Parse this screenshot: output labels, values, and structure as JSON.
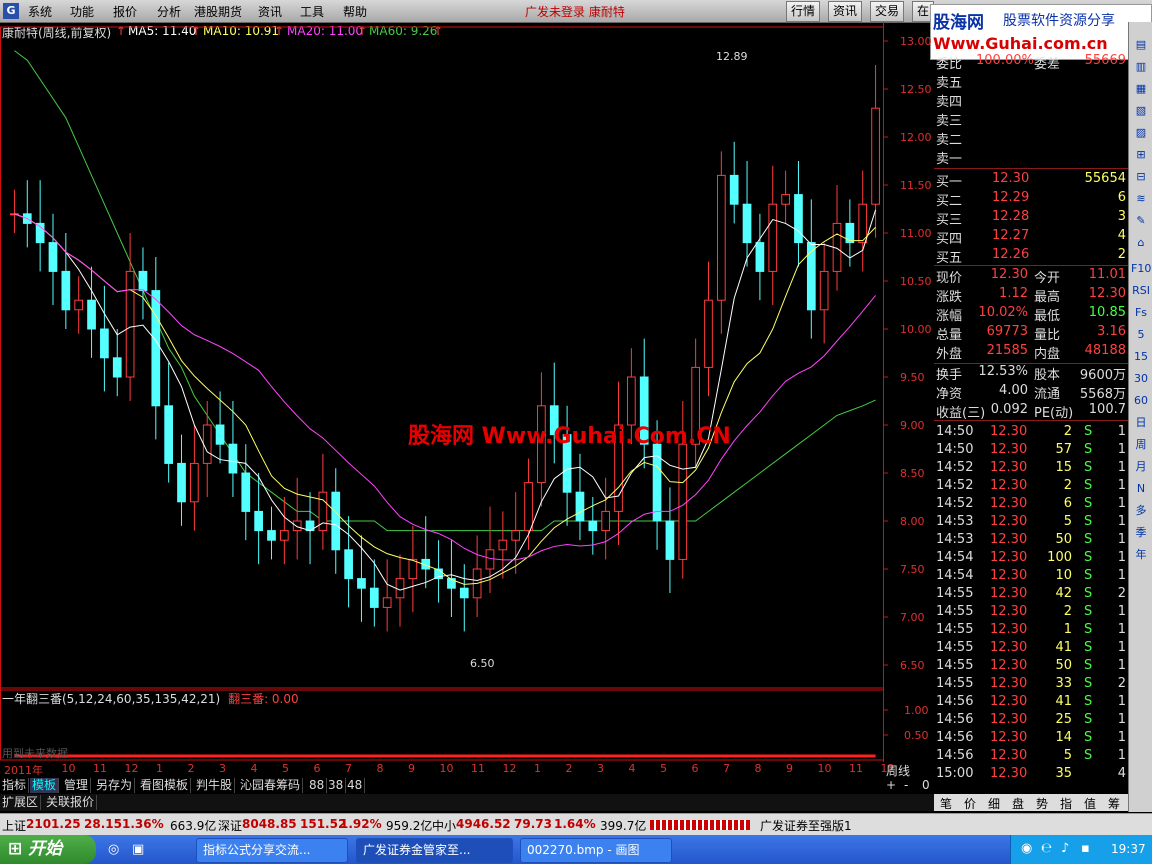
{
  "menubar": {
    "items": [
      "系统",
      "功能",
      "报价",
      "分析",
      "港股期货",
      "资讯",
      "工具",
      "帮助"
    ],
    "title": "广发未登录 康耐特",
    "right_buttons": [
      "行情",
      "资讯",
      "交易",
      "在"
    ]
  },
  "logo": {
    "name": "股海网",
    "slogan": "股票软件资源分享",
    "url": "Www.Guhai.com.cn"
  },
  "header": {
    "stock_label": "康耐特(周线,前复权)",
    "ma5": "MA5: 11.40",
    "ma10": "MA10: 10.91",
    "ma20": "MA20: 11.00",
    "ma60": "MA60: 9.26"
  },
  "colors": {
    "up": "#ff3c3c",
    "down": "#54ffff",
    "ma5": "#ffffff",
    "ma10": "#ffff66",
    "ma20": "#ff44ff",
    "ma60": "#44cc44",
    "axis": "#d01010",
    "signal": "#ff2020"
  },
  "price_axis": {
    "ticks": [
      "13.00",
      "12.50",
      "12.00",
      "11.50",
      "11.00",
      "10.50",
      "10.00",
      "9.50",
      "9.00",
      "8.50",
      "8.00",
      "7.50",
      "7.00",
      "6.50"
    ]
  },
  "price_labels": {
    "high": "12.89",
    "low": "6.50"
  },
  "indicator": {
    "label": "一年翻三番(5,12,24,60,35,135,42,21)",
    "value_label": "翻三番: 0.00",
    "ticks": [
      "1.00",
      "0.50"
    ],
    "note": "用到未来数据"
  },
  "time_axis": {
    "labels": [
      "2011年",
      "10",
      "11",
      "12",
      "1",
      "2",
      "3",
      "4",
      "5",
      "6",
      "7",
      "8",
      "9",
      "10",
      "11",
      "12",
      "1",
      "2",
      "3",
      "4",
      "5",
      "6",
      "7",
      "8",
      "9",
      "10",
      "11",
      "12"
    ],
    "period": "周线"
  },
  "watermark": "股海网 Www.Guhai.Com.CN",
  "tabs": [
    "指标",
    "模板",
    "管理",
    "另存为",
    "看图模板",
    "判牛股",
    "沁园春筹码",
    "88",
    "38",
    "48"
  ],
  "tabs2": [
    "扩展区",
    "关联报价"
  ],
  "zoom_buttons": [
    "+",
    "-",
    "0"
  ],
  "quote": {
    "webi": {
      "label": "委比",
      "value": "100.00%",
      "label2": "委差",
      "value2": "55669"
    },
    "sells": [
      "卖五",
      "卖四",
      "卖三",
      "卖二",
      "卖一"
    ],
    "buys": [
      {
        "label": "买一",
        "price": "12.30",
        "vol": "55654"
      },
      {
        "label": "买二",
        "price": "12.29",
        "vol": "6"
      },
      {
        "label": "买三",
        "price": "12.28",
        "vol": "3"
      },
      {
        "label": "买四",
        "price": "12.27",
        "vol": "4"
      },
      {
        "label": "买五",
        "price": "12.26",
        "vol": "2"
      }
    ],
    "stats": [
      {
        "l1": "现价",
        "v1": "12.30",
        "l2": "今开",
        "v2": "11.01"
      },
      {
        "l1": "涨跌",
        "v1": "1.12",
        "l2": "最高",
        "v2": "12.30"
      },
      {
        "l1": "涨幅",
        "v1": "10.02%",
        "l2": "最低",
        "v2": "10.85"
      },
      {
        "l1": "总量",
        "v1": "69773",
        "l2": "量比",
        "v2": "3.16"
      },
      {
        "l1": "外盘",
        "v1": "21585",
        "l2": "内盘",
        "v2": "48188"
      }
    ],
    "stats2": [
      {
        "l1": "换手",
        "v1": "12.53%",
        "l2": "股本",
        "v2": "9600万"
      },
      {
        "l1": "净资",
        "v1": "4.00",
        "l2": "流通",
        "v2": "5568万"
      },
      {
        "l1": "收益(三)",
        "v1": "0.092",
        "l2": "PE(动)",
        "v2": "100.7"
      }
    ],
    "ticks": [
      {
        "t": "14:50",
        "p": "12.30",
        "v": "2",
        "s": "S",
        "n": "1"
      },
      {
        "t": "14:50",
        "p": "12.30",
        "v": "57",
        "s": "S",
        "n": "1"
      },
      {
        "t": "14:52",
        "p": "12.30",
        "v": "15",
        "s": "S",
        "n": "1"
      },
      {
        "t": "14:52",
        "p": "12.30",
        "v": "2",
        "s": "S",
        "n": "1"
      },
      {
        "t": "14:52",
        "p": "12.30",
        "v": "6",
        "s": "S",
        "n": "1"
      },
      {
        "t": "14:53",
        "p": "12.30",
        "v": "5",
        "s": "S",
        "n": "1"
      },
      {
        "t": "14:53",
        "p": "12.30",
        "v": "50",
        "s": "S",
        "n": "1"
      },
      {
        "t": "14:54",
        "p": "12.30",
        "v": "100",
        "s": "S",
        "n": "1"
      },
      {
        "t": "14:54",
        "p": "12.30",
        "v": "10",
        "s": "S",
        "n": "1"
      },
      {
        "t": "14:55",
        "p": "12.30",
        "v": "42",
        "s": "S",
        "n": "2"
      },
      {
        "t": "14:55",
        "p": "12.30",
        "v": "2",
        "s": "S",
        "n": "1"
      },
      {
        "t": "14:55",
        "p": "12.30",
        "v": "1",
        "s": "S",
        "n": "1"
      },
      {
        "t": "14:55",
        "p": "12.30",
        "v": "41",
        "s": "S",
        "n": "1"
      },
      {
        "t": "14:55",
        "p": "12.30",
        "v": "50",
        "s": "S",
        "n": "1"
      },
      {
        "t": "14:55",
        "p": "12.30",
        "v": "33",
        "s": "S",
        "n": "2"
      },
      {
        "t": "14:56",
        "p": "12.30",
        "v": "41",
        "s": "S",
        "n": "1"
      },
      {
        "t": "14:56",
        "p": "12.30",
        "v": "25",
        "s": "S",
        "n": "1"
      },
      {
        "t": "14:56",
        "p": "12.30",
        "v": "14",
        "s": "S",
        "n": "1"
      },
      {
        "t": "14:56",
        "p": "12.30",
        "v": "5",
        "s": "S",
        "n": "1"
      },
      {
        "t": "15:00",
        "p": "12.30",
        "v": "35",
        "s": "",
        "n": "4"
      }
    ]
  },
  "right_tabs": [
    "笔",
    "价",
    "细",
    "盘",
    "势",
    "指",
    "值",
    "筹"
  ],
  "right_tools": [
    "F10",
    "RSI",
    "Fs",
    "5",
    "15",
    "30",
    "60",
    "日",
    "周",
    "月",
    "N",
    "多",
    "季",
    "年"
  ],
  "status": {
    "sh_label": "上证",
    "sh_index": "2101.25",
    "sh_chg": "28.15",
    "sh_pct": "1.36%",
    "sh_amt": "663.9亿",
    "sz_label": "深证",
    "sz_index": "8048.85",
    "sz_chg": "151.52",
    "sz_pct": "1.92%",
    "sz_amt": "959.2亿",
    "zx_label": "中小",
    "zx_index": "4946.52",
    "zx_chg": "79.73",
    "zx_pct": "1.64%",
    "zx_amt": "399.7亿",
    "broker": "广发证券至强版1"
  },
  "taskbar": {
    "start": "开始",
    "tasks": [
      "指标公式分享交流...",
      "广发证券金管家至...",
      "002270.bmp - 画图"
    ],
    "clock": "19:37"
  },
  "chart_data": {
    "type": "candlestick",
    "title": "康耐特(周线,前复权)",
    "ylim": [
      6.3,
      13.1
    ],
    "close_path_note": "weekly candles with MA5/MA10/MA20/MA60",
    "close": [
      11.2,
      11.1,
      10.9,
      10.6,
      10.2,
      10.3,
      10.0,
      9.7,
      9.5,
      10.6,
      10.4,
      9.2,
      8.6,
      8.2,
      8.6,
      9.0,
      8.8,
      8.5,
      8.1,
      7.9,
      7.8,
      7.9,
      8.0,
      7.9,
      8.3,
      7.7,
      7.4,
      7.3,
      7.1,
      7.2,
      7.4,
      7.6,
      7.5,
      7.4,
      7.3,
      7.2,
      7.5,
      7.7,
      7.8,
      7.9,
      8.4,
      9.2,
      8.9,
      8.3,
      8.0,
      7.9,
      8.1,
      9.0,
      9.5,
      8.8,
      8.0,
      7.6,
      8.8,
      9.6,
      10.3,
      11.6,
      11.3,
      10.9,
      10.6,
      11.3,
      11.4,
      10.9,
      10.2,
      10.6,
      11.1,
      10.9,
      11.3,
      12.3
    ],
    "ma60": [
      12.9,
      12.8,
      12.6,
      12.4,
      12.2,
      11.9,
      11.6,
      11.3,
      11.0,
      10.7,
      10.4,
      10.1,
      9.8,
      9.6,
      9.3,
      9.1,
      8.9,
      8.7,
      8.5,
      8.4,
      8.3,
      8.2,
      8.1,
      8.1,
      8.0,
      8.0,
      8.0,
      8.0,
      8.0,
      7.9,
      7.9,
      7.9,
      7.9,
      7.9,
      7.9,
      7.9,
      7.9,
      7.9,
      7.9,
      7.9,
      7.9,
      7.9,
      8.0,
      8.0,
      8.0,
      8.0,
      8.0,
      8.0,
      8.0,
      8.0,
      8.0,
      8.0,
      8.0,
      8.0,
      8.1,
      8.2,
      8.3,
      8.4,
      8.5,
      8.6,
      8.7,
      8.8,
      8.9,
      9.0,
      9.1,
      9.15,
      9.2,
      9.26
    ],
    "signal": [
      0,
      0,
      0,
      0,
      0,
      0,
      0,
      0,
      0,
      0,
      0,
      0,
      0,
      0,
      0,
      0,
      0,
      0,
      0,
      0,
      0,
      0,
      0,
      0,
      0,
      0,
      0,
      0,
      0,
      0,
      0,
      0,
      0,
      0,
      0,
      0,
      0,
      0,
      0,
      0,
      0,
      0,
      0,
      0,
      0,
      0,
      0,
      0,
      0,
      0,
      0,
      0,
      0,
      0,
      0,
      0,
      0,
      0,
      0,
      0,
      0,
      0,
      0,
      0,
      0,
      0,
      0,
      0
    ]
  }
}
